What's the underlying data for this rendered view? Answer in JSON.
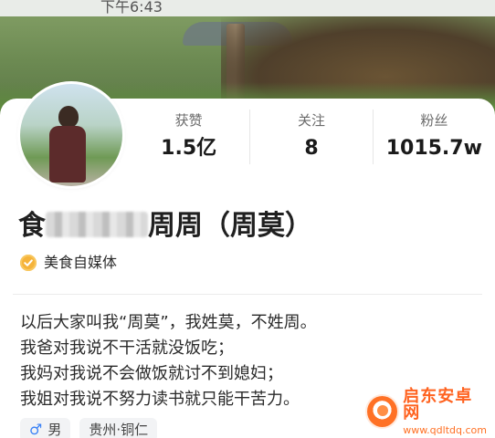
{
  "status_bar": {
    "time": "下午6:43"
  },
  "stats": [
    {
      "label": "获赞",
      "value": "1.5亿"
    },
    {
      "label": "关注",
      "value": "8"
    },
    {
      "label": "粉丝",
      "value": "1015.7w"
    }
  ],
  "profile": {
    "name_prefix": "食",
    "name_suffix": "周周（周莫）",
    "verification": "美食自媒体",
    "bio_lines": [
      "以后大家叫我“周莫”，我姓莫，不姓周。",
      "我爸对我说不干活就没饭吃；",
      "我妈对我说不会做饭就讨不到媳妇；",
      "我姐对我说不努力读书就只能干苦力。"
    ]
  },
  "tags": [
    {
      "icon": "male-icon",
      "label": "男"
    },
    {
      "label": "贵州·铜仁"
    }
  ],
  "watermark": {
    "title": "启东安卓网",
    "url": "www.qdltdq.com",
    "brand_color": "#ff5a14"
  },
  "colors": {
    "verify_badge": "#f5b33a",
    "male_icon": "#3b82f6",
    "text_primary": "#1a1a1a",
    "text_secondary": "#6a6a6a"
  }
}
